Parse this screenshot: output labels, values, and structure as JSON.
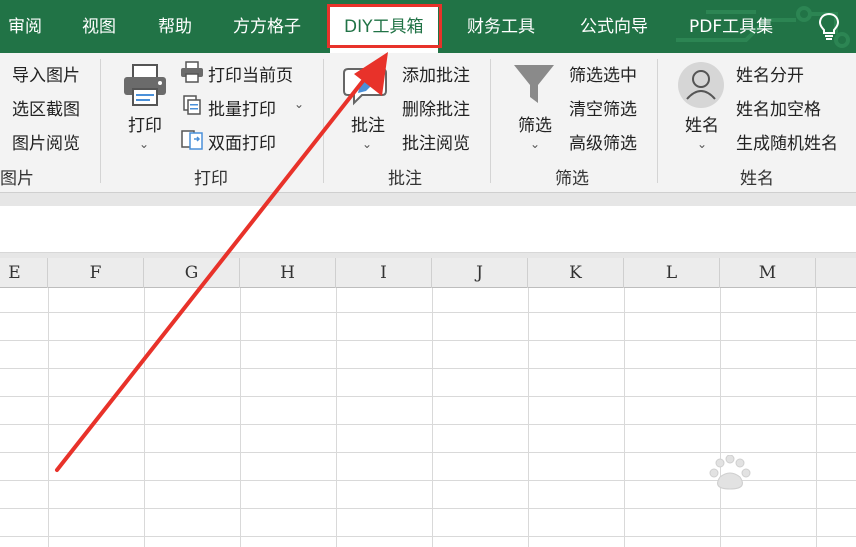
{
  "tabs": [
    {
      "label": "审阅",
      "active": false
    },
    {
      "label": "视图",
      "active": false
    },
    {
      "label": "帮助",
      "active": false
    },
    {
      "label": "方方格子",
      "active": false
    },
    {
      "label": "DIY工具箱",
      "active": true
    },
    {
      "label": "财务工具",
      "active": false
    },
    {
      "label": "公式向导",
      "active": false
    },
    {
      "label": "PDF工具集",
      "active": false
    }
  ],
  "help_icon": "lightbulb-icon",
  "ribbon": {
    "image_group": {
      "label": "图片",
      "items": [
        "导入图片",
        "选区截图",
        "图片阅览"
      ]
    },
    "print_group": {
      "label": "打印",
      "big_button": "打印",
      "items": [
        "打印当前页",
        "批量打印",
        "双面打印"
      ],
      "icons": [
        "printer-icon",
        "print-page-icon",
        "batch-print-icon",
        "duplex-print-icon"
      ]
    },
    "comment_group": {
      "label": "批注",
      "big_button": "批注",
      "items": [
        "添加批注",
        "删除批注",
        "批注阅览"
      ],
      "icons": [
        "comment-icon"
      ]
    },
    "filter_group": {
      "label": "筛选",
      "big_button": "筛选",
      "items": [
        "筛选选中",
        "清空筛选",
        "高级筛选"
      ],
      "icons": [
        "funnel-icon"
      ]
    },
    "name_group": {
      "label": "姓名",
      "big_button": "姓名",
      "items": [
        "姓名分开",
        "姓名加空格",
        "生成随机姓名"
      ],
      "icons": [
        "person-avatar-icon"
      ]
    }
  },
  "columns": [
    "E",
    "F",
    "G",
    "H",
    "I",
    "J",
    "K",
    "L",
    "M"
  ],
  "colors": {
    "tab_bar": "#217346",
    "highlight": "#e8322a",
    "arrow": "#e8322a",
    "ribbon_bg": "#f3f3f3"
  }
}
